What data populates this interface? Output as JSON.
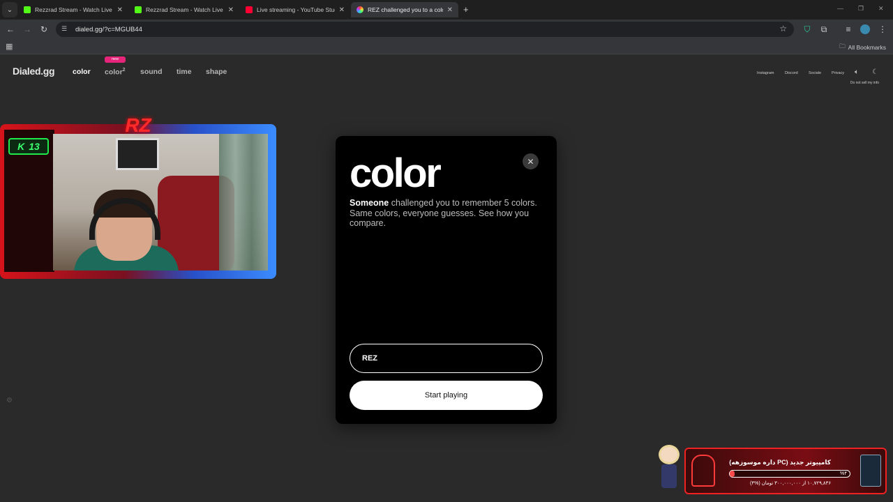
{
  "browser": {
    "tabs": [
      {
        "title": "Rezzrad Stream - Watch Live on",
        "favicon_color": "#53fc18",
        "active": false
      },
      {
        "title": "Rezzrad Stream - Watch Live on",
        "favicon_color": "#53fc18",
        "active": false
      },
      {
        "title": "Live streaming - YouTube Studio",
        "favicon_color": "#ff0033",
        "active": false
      },
      {
        "title": "REZ challenged you to a color m",
        "favicon_color": "#ff9a3c",
        "active": true
      }
    ],
    "url": "dialed.gg/?c=MGUB44",
    "bookmarks_label": "All Bookmarks"
  },
  "site": {
    "logo": "Dialed.gg",
    "nav": [
      {
        "label": "color",
        "active": true
      },
      {
        "label": "color",
        "sup": "2",
        "active": false
      },
      {
        "label": "sound",
        "active": false
      },
      {
        "label": "time",
        "active": false
      },
      {
        "label": "shape",
        "active": false
      }
    ],
    "new_badge": "new",
    "right_links": [
      "Instagram",
      "Discord",
      "Sociale",
      "Privacy"
    ],
    "do_not_sell": "Do not sell my info"
  },
  "stream_overlay": {
    "badge_count": "13",
    "logo_text": "RZ"
  },
  "modal": {
    "title": "color",
    "desc_bold": "Someone",
    "desc_rest": " challenged you to remember 5 colors. Same colors, everyone guesses. See how you compare.",
    "name_value": "REZ",
    "start_label": "Start playing",
    "close_glyph": "✕"
  },
  "donation": {
    "title": "کامپیوتر جدید (PC داره موسوزهه)",
    "percent": "%۴",
    "amount": "۱۰,۷۲۹,۸۳۶ از ۳۰۰,۰۰۰,۰۰۰ تومان (%۴)",
    "progress_percent": 4
  }
}
